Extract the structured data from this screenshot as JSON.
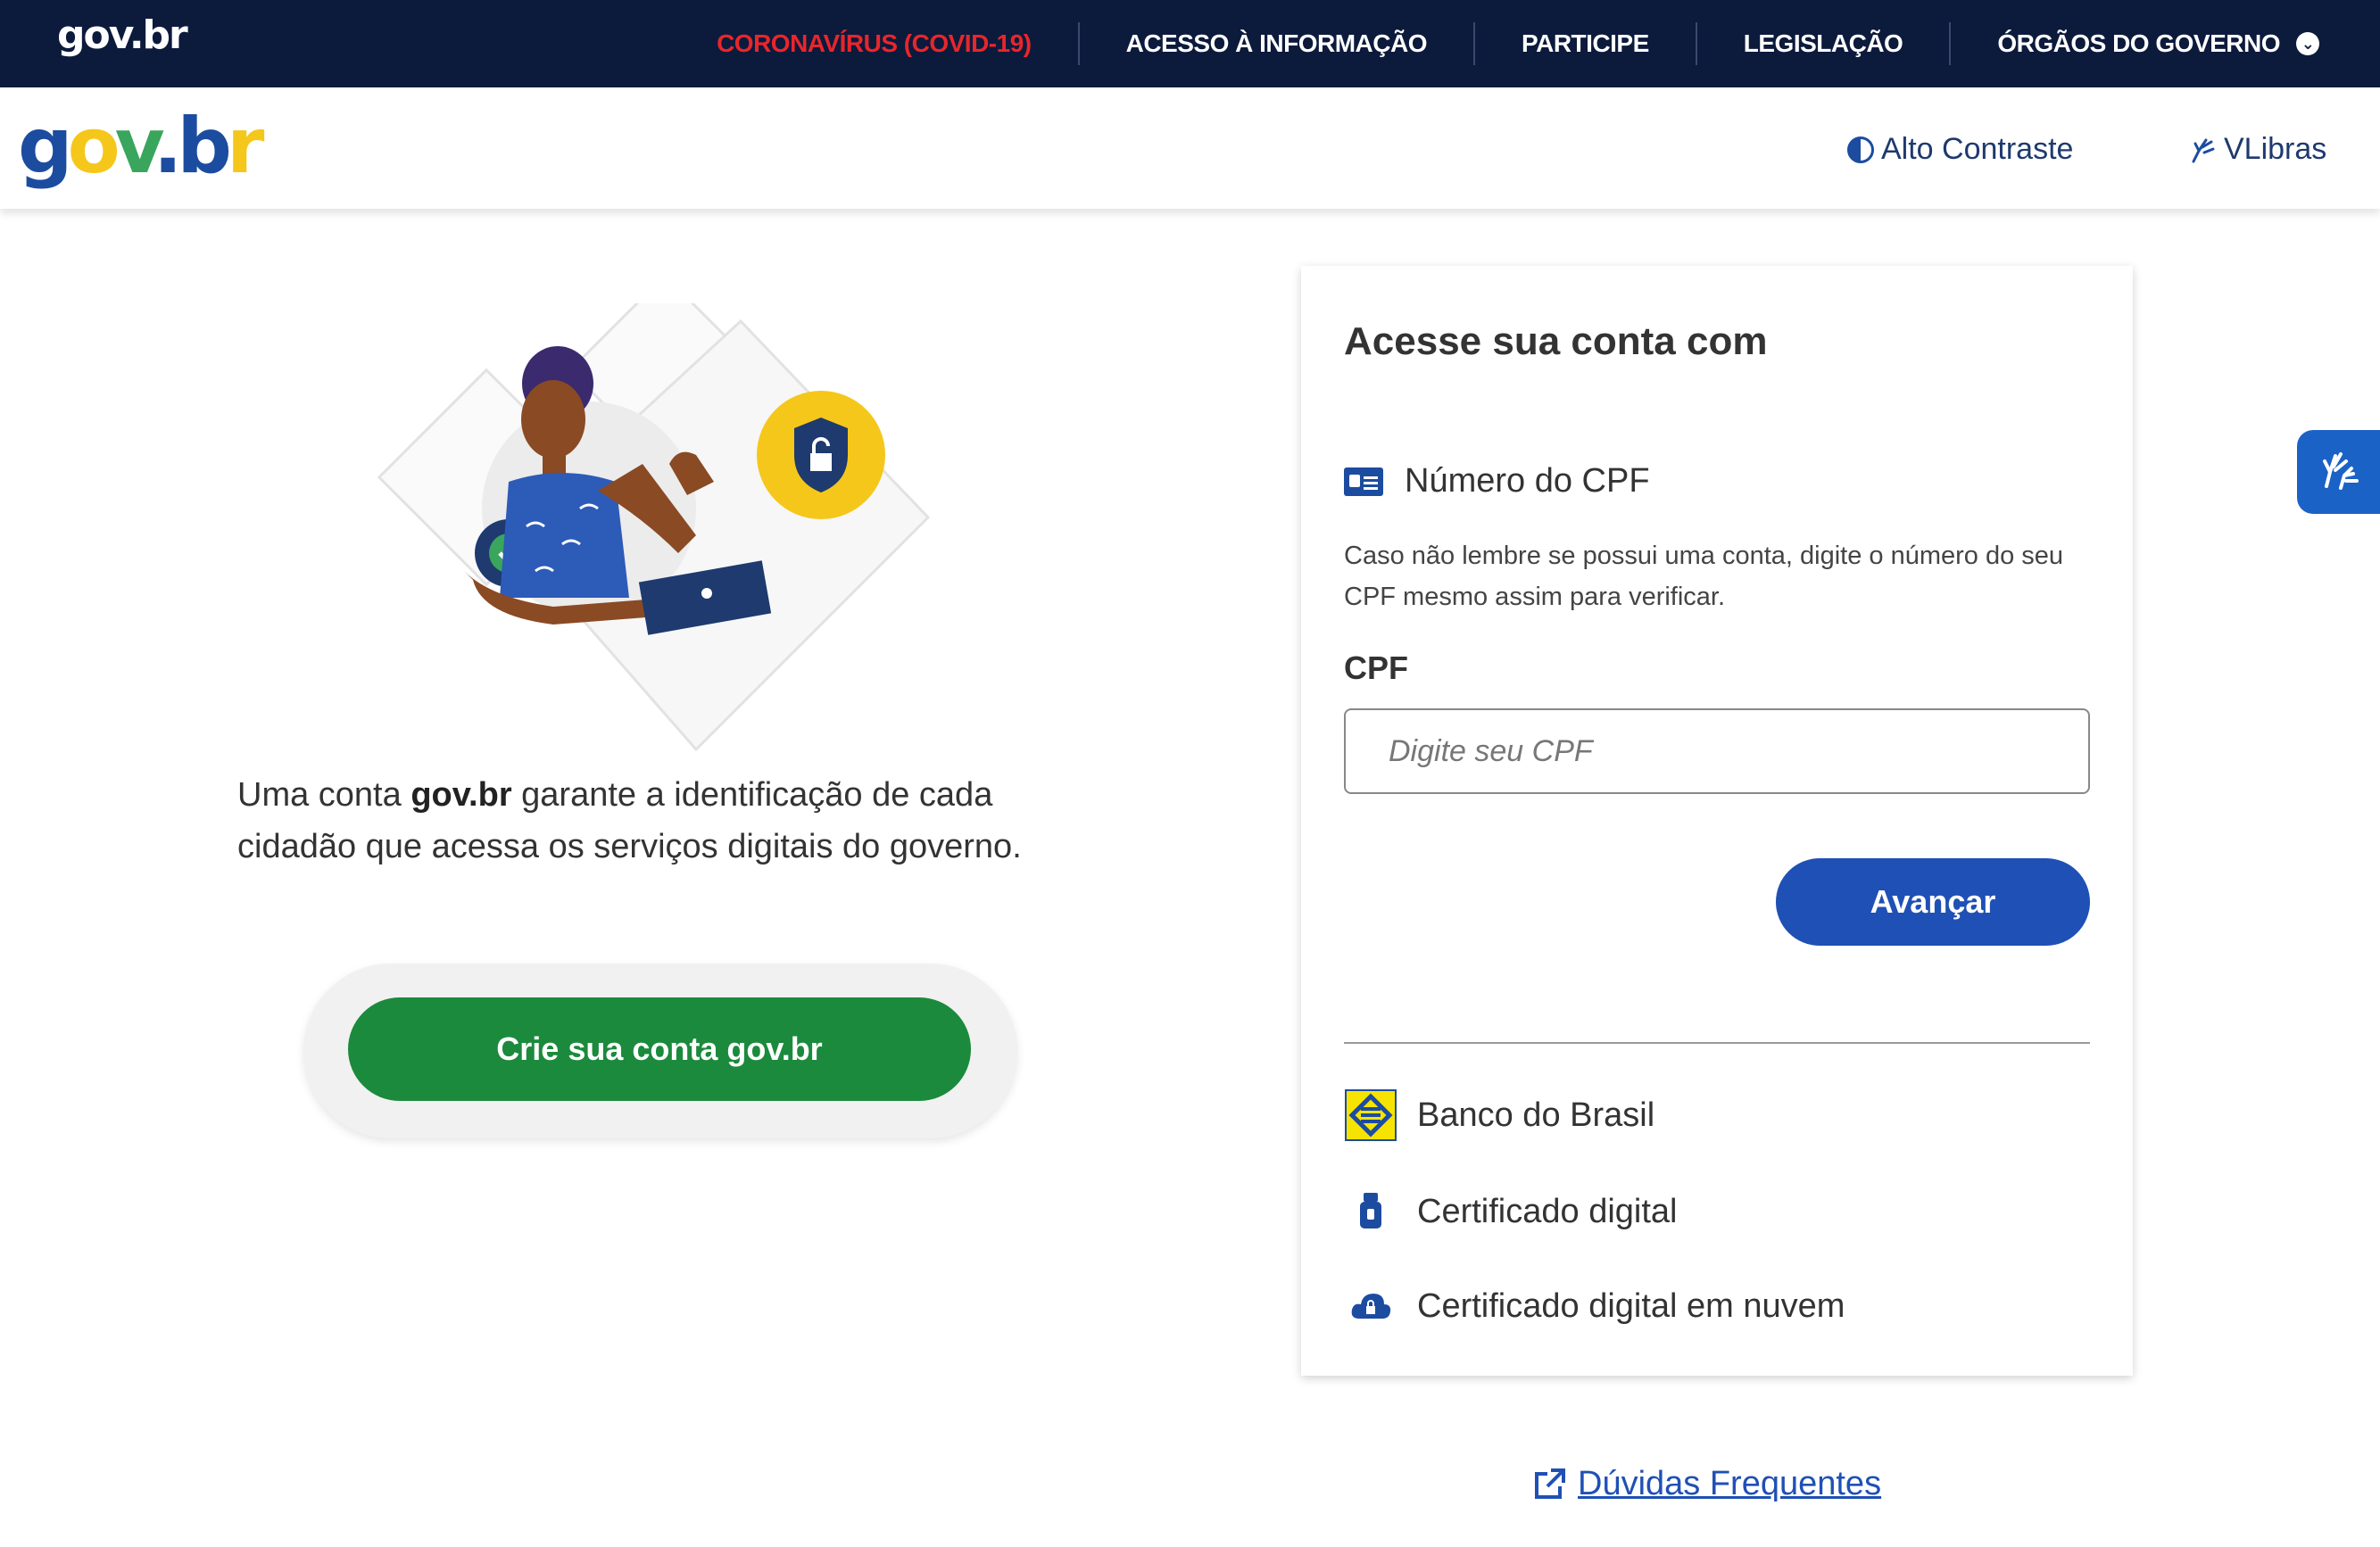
{
  "topbar": {
    "brand": "gov.br",
    "nav": [
      {
        "label": "CORONAVÍRUS (COVID-19)"
      },
      {
        "label": "ACESSO À INFORMAÇÃO"
      },
      {
        "label": "PARTICIPE"
      },
      {
        "label": "LEGISLAÇÃO"
      },
      {
        "label": "ÓRGÃOS DO GOVERNO"
      }
    ]
  },
  "header": {
    "logo": "gov.br",
    "contrast_label": "Alto Contraste",
    "libras_label": "VLibras"
  },
  "intro": {
    "desc_pre": "Uma conta ",
    "desc_bold": "gov.br",
    "desc_post": " garante a identificação de cada cidadão que acessa os serviços digitais do governo.",
    "cta_label": "Crie sua conta gov.br"
  },
  "login": {
    "title": "Acesse sua conta com",
    "cpf_option": "Número do CPF",
    "hint": "Caso não lembre se possui uma conta, digite o número do seu CPF mesmo assim para verificar.",
    "cpf_label": "CPF",
    "cpf_placeholder": "Digite seu CPF",
    "cpf_value": "",
    "next_label": "Avançar",
    "options": [
      {
        "label": "Banco do Brasil",
        "icon": "banco-do-brasil-icon"
      },
      {
        "label": "Certificado digital",
        "icon": "usb-token-icon"
      },
      {
        "label": "Certificado digital em nuvem",
        "icon": "cloud-lock-icon"
      }
    ]
  },
  "footer": {
    "faq_label": "Dúvidas Frequentes"
  },
  "colors": {
    "topbar": "#0c1a3c",
    "covid": "#e8262b",
    "primary": "#1f50b5",
    "cta_green": "#1b8a3c"
  }
}
